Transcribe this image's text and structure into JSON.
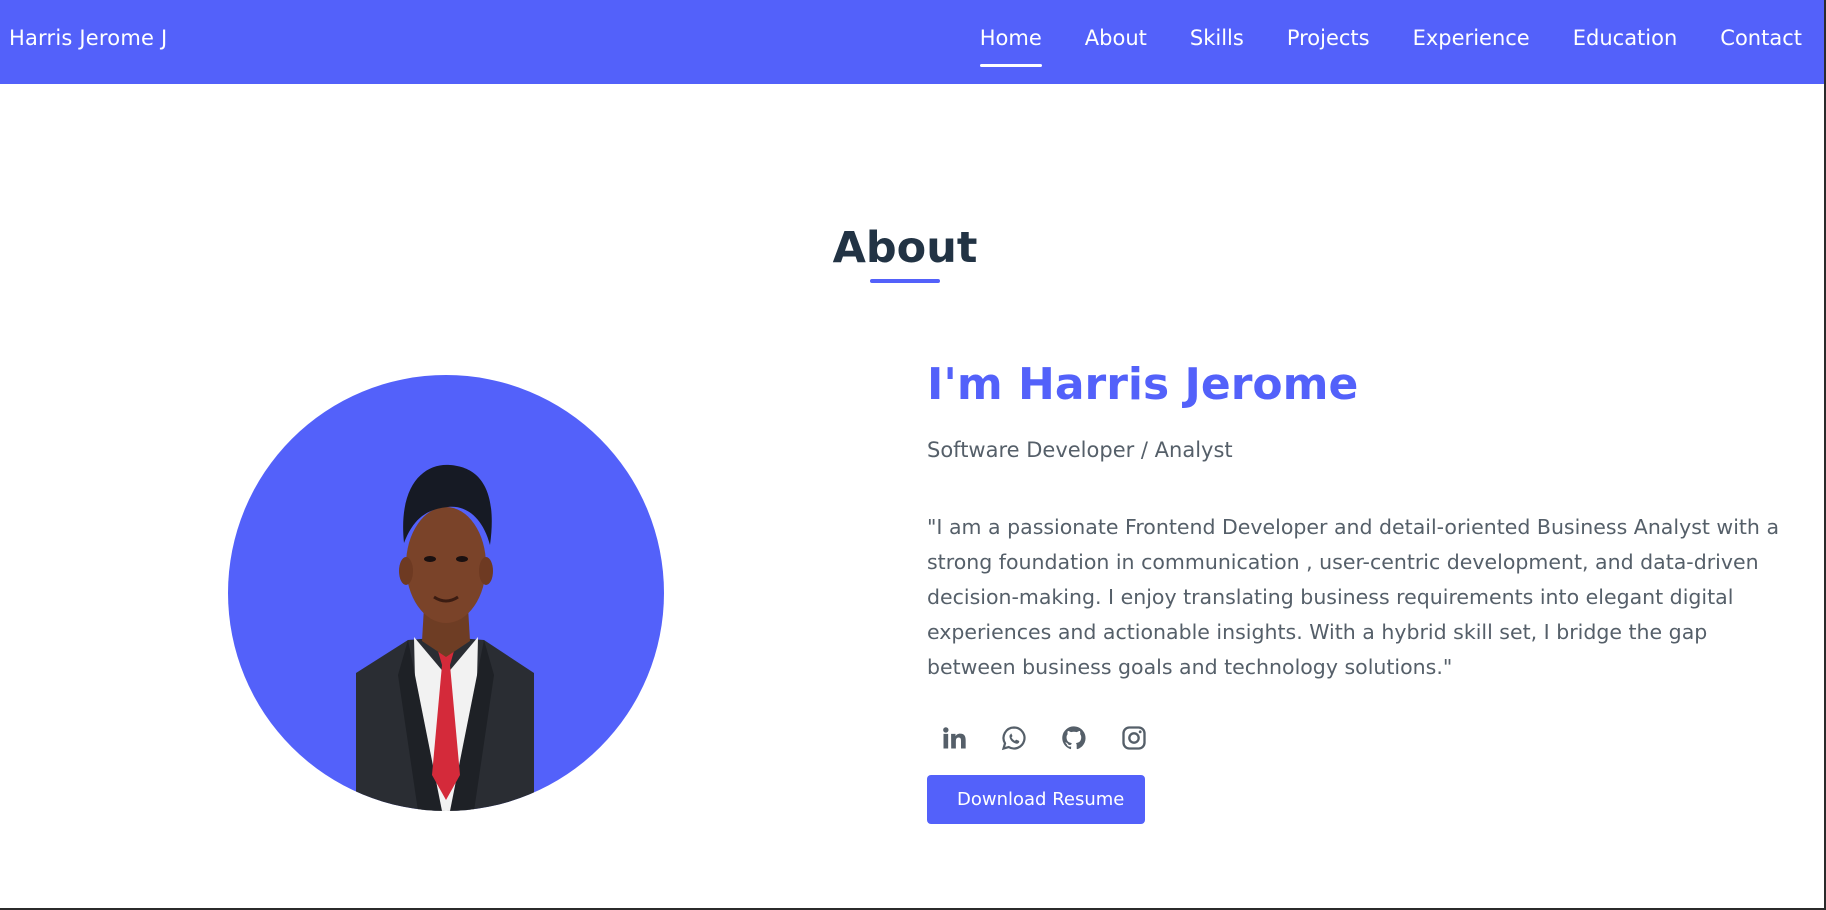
{
  "theme": {
    "primary": "#5361fa",
    "heading": "#223344",
    "text": "#555f69"
  },
  "navbar": {
    "brand": "Harris Jerome J",
    "links": [
      {
        "label": "Home",
        "active": true
      },
      {
        "label": "About"
      },
      {
        "label": "Skills"
      },
      {
        "label": "Projects"
      },
      {
        "label": "Experience"
      },
      {
        "label": "Education"
      },
      {
        "label": "Contact"
      }
    ]
  },
  "about": {
    "title": "About",
    "greeting": "I'm Harris Jerome",
    "role": "Software Developer / Analyst",
    "bio": "\"I am a passionate Frontend Developer and detail-oriented Business Analyst with a strong foundation in communication , user-centric development, and data-driven decision-making. I enjoy translating business requirements into elegant digital experiences and actionable insights. With a hybrid skill set, I bridge the gap between business goals and technology solutions.\"",
    "socials": [
      "linkedin-icon",
      "whatsapp-icon",
      "github-icon",
      "instagram-icon"
    ],
    "download_label": "Download Resume"
  }
}
